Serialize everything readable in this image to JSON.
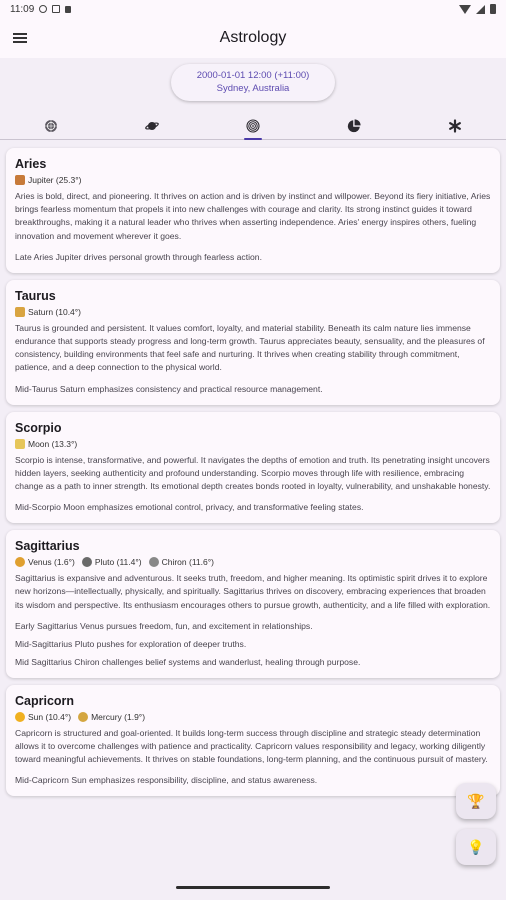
{
  "status_bar": {
    "time": "11:09"
  },
  "app_bar": {
    "title": "Astrology",
    "menu_icon": "hamburger-menu-icon"
  },
  "chart_info": {
    "datetime": "2000-01-01 12:00 (+11:00)",
    "location": "Sydney, Australia"
  },
  "tabs": [
    {
      "name": "zodiac-wheel-icon",
      "active": false
    },
    {
      "name": "planet-icon",
      "active": false
    },
    {
      "name": "target-rings-icon",
      "active": true
    },
    {
      "name": "pie-chart-icon",
      "active": false
    },
    {
      "name": "asterisk-icon",
      "active": false
    }
  ],
  "cards": [
    {
      "sign": "Aries",
      "planets": [
        {
          "label": "Jupiter (25.3°)",
          "color": "#c77a3a"
        }
      ],
      "description": "Aries is bold, direct, and pioneering. It thrives on action and is driven by instinct and willpower. Beyond its fiery initiative, Aries brings fearless momentum that propels it into new challenges with courage and clarity. Its strong instinct guides it toward breakthroughs, making it a natural leader who thrives when asserting independence. Aries' energy inspires others, fueling innovation and movement wherever it goes.",
      "notes": [
        "Late Aries Jupiter drives personal growth through fearless action."
      ]
    },
    {
      "sign": "Taurus",
      "planets": [
        {
          "label": "Saturn (10.4°)",
          "color": "#d9a441"
        }
      ],
      "description": "Taurus is grounded and persistent. It values comfort, loyalty, and material stability. Beneath its calm nature lies immense endurance that supports steady progress and long-term growth. Taurus appreciates beauty, sensuality, and the pleasures of consistency, building environments that feel safe and nurturing. It thrives when creating stability through commitment, patience, and a deep connection to the physical world.",
      "notes": [
        "Mid-Taurus Saturn emphasizes consistency and practical resource management."
      ]
    },
    {
      "sign": "Scorpio",
      "planets": [
        {
          "label": "Moon (13.3°)",
          "color": "#e6c65a"
        }
      ],
      "description": "Scorpio is intense, transformative, and powerful. It navigates the depths of emotion and truth. Its penetrating insight uncovers hidden layers, seeking authenticity and profound understanding. Scorpio moves through life with resilience, embracing change as a path to inner strength. Its emotional depth creates bonds rooted in loyalty, vulnerability, and unshakable honesty.",
      "notes": [
        "Mid-Scorpio Moon emphasizes emotional control, privacy, and transformative feeling states."
      ]
    },
    {
      "sign": "Sagittarius",
      "planets": [
        {
          "label": "Venus (1.6°)",
          "color": "#e0a030"
        },
        {
          "label": "Pluto (11.4°)",
          "color": "#6a6a6a"
        },
        {
          "label": "Chiron (11.6°)",
          "color": "#888888"
        }
      ],
      "description": "Sagittarius is expansive and adventurous. It seeks truth, freedom, and higher meaning. Its optimistic spirit drives it to explore new horizons—intellectually, physically, and spiritually. Sagittarius thrives on discovery, embracing experiences that broaden its wisdom and perspective. Its enthusiasm encourages others to pursue growth, authenticity, and a life filled with exploration.",
      "notes": [
        "Early Sagittarius Venus pursues freedom, fun, and excitement in relationships.",
        "Mid-Sagittarius Pluto pushes for exploration of deeper truths.",
        "Mid Sagittarius Chiron challenges belief systems and wanderlust, healing through purpose."
      ]
    },
    {
      "sign": "Capricorn",
      "planets": [
        {
          "label": "Sun (10.4°)",
          "color": "#f0b020"
        },
        {
          "label": "Mercury (1.9°)",
          "color": "#d4a640"
        }
      ],
      "description": "Capricorn is structured and goal-oriented. It builds long-term success through discipline and strategic steady determination allows it to overcome challenges with patience and practicality. Capricorn values responsibility and legacy, working diligently toward meaningful achievements. It thrives on stable foundations, long-term planning, and the continuous pursuit of mastery.",
      "notes": [
        "Mid-Capricorn Sun emphasizes responsibility, discipline, and status awareness."
      ]
    }
  ],
  "fabs": [
    {
      "name": "trophy-icon",
      "glyph": "🏆"
    },
    {
      "name": "lightbulb-icon",
      "glyph": "💡"
    }
  ]
}
